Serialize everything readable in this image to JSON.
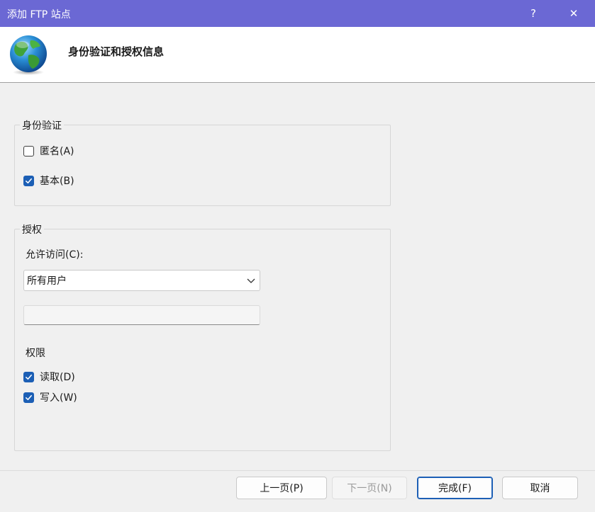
{
  "window": {
    "title": "添加 FTP 站点",
    "help_label": "?",
    "close_label": "✕"
  },
  "header": {
    "title": "身份验证和授权信息"
  },
  "authentication": {
    "legend": "身份验证",
    "anonymous": {
      "label": "匿名(A)",
      "checked": false
    },
    "basic": {
      "label": "基本(B)",
      "checked": true
    }
  },
  "authorization": {
    "legend": "授权",
    "allow_access_label": "允许访问(C):",
    "allow_access_value": "所有用户",
    "users_input_value": "",
    "permissions_label": "权限",
    "read": {
      "label": "读取(D)",
      "checked": true
    },
    "write": {
      "label": "写入(W)",
      "checked": true
    }
  },
  "buttons": {
    "previous": "上一页(P)",
    "next": "下一页(N)",
    "finish": "完成(F)",
    "cancel": "取消"
  },
  "colors": {
    "titlebar": "#6b68d4",
    "accent": "#1c5fb5"
  }
}
